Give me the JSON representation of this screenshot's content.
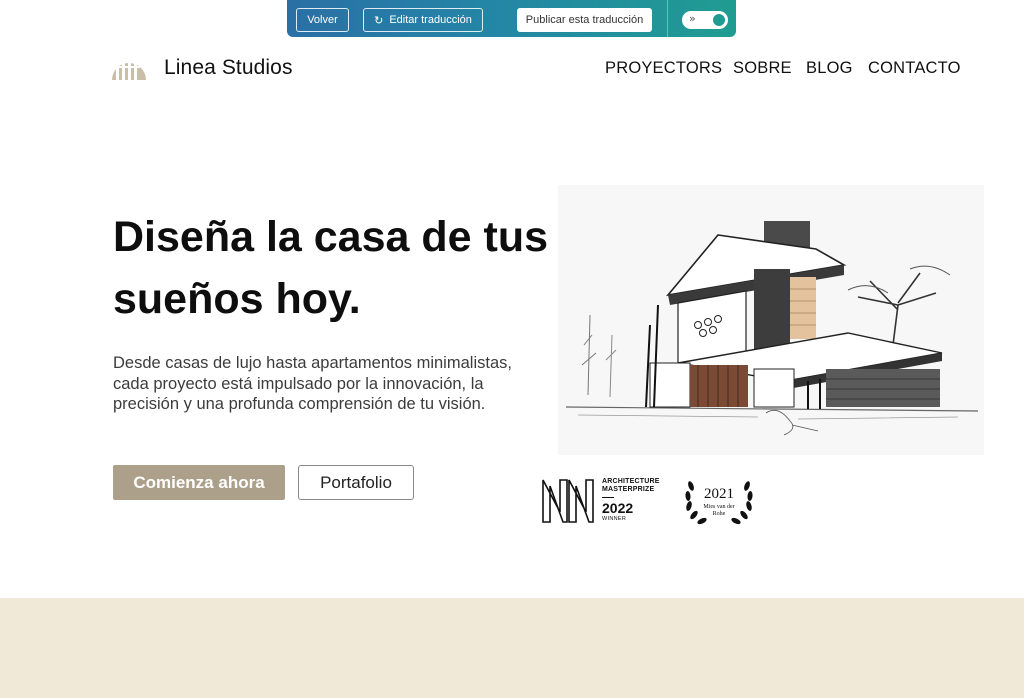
{
  "toolbar": {
    "back_label": "Volver",
    "edit_label": "Editar traducción",
    "publish_label": "Publicar esta traducción",
    "colors": {
      "gradient_start": "#2a6fa5",
      "gradient_end": "#1f9c91"
    }
  },
  "header": {
    "brand": "Linea Studios",
    "nav": [
      "PROYECTORS",
      "SOBRE",
      "BLOG",
      "CONTACTO"
    ]
  },
  "hero": {
    "headline_line1": "Diseña la casa de tus",
    "headline_line2": "sueños hoy.",
    "paragraph": "Desde casas de lujo hasta apartamentos minimalistas, cada proyecto está impulsado por la innovación, la precisión y una profunda comprensión de tu visión.",
    "primary_button": "Comienza ahora",
    "secondary_button": "Portafolio",
    "accent_color": "#ada08a"
  },
  "awards": [
    {
      "line1": "ARCHITECTURE",
      "line2": "MASTERPRIZE",
      "year": "2022",
      "label": "WINNER"
    },
    {
      "year": "2021",
      "line1": "Mies van der",
      "line2": "Rohe"
    }
  ],
  "footer": {
    "band_color": "#f1e9d8"
  }
}
